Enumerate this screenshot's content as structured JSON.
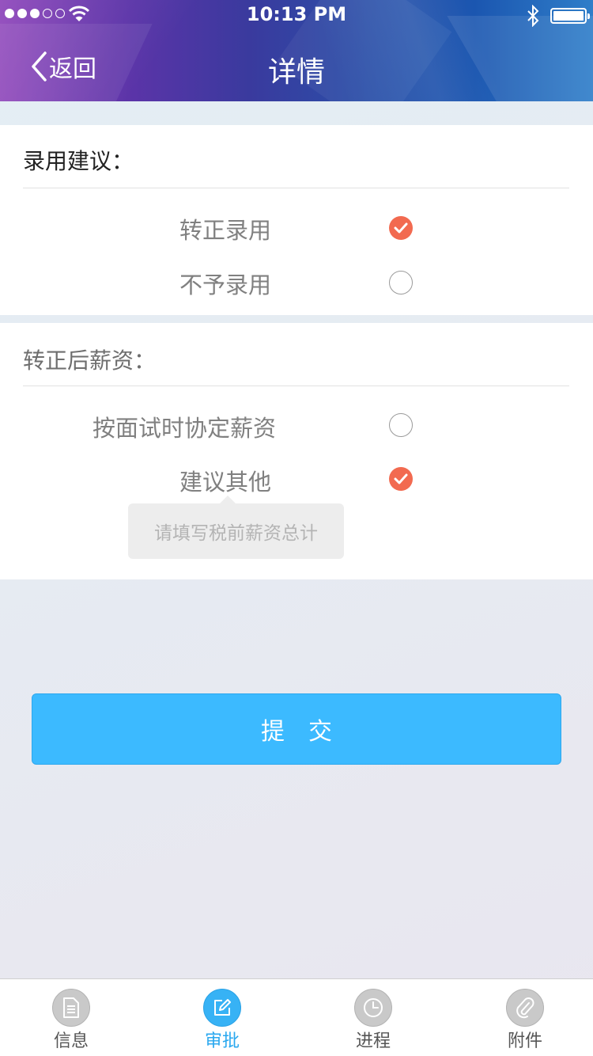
{
  "status_bar": {
    "time": "10:13 PM",
    "signal_filled": 3,
    "signal_total": 5,
    "battery_level": 1.0,
    "icons": [
      "signal-dots",
      "wifi-icon",
      "bluetooth-icon",
      "battery-icon"
    ]
  },
  "nav": {
    "back_label": "返回",
    "title": "详情"
  },
  "hire_section": {
    "title": "录用建议：",
    "options": [
      {
        "label": "转正录用",
        "selected": true
      },
      {
        "label": "不予录用",
        "selected": false
      }
    ]
  },
  "salary_section": {
    "title": "转正后薪资：",
    "options": [
      {
        "label": "按面试时协定薪资",
        "selected": false
      },
      {
        "label": "建议其他",
        "selected": true
      }
    ],
    "input_placeholder": "请填写税前薪资总计"
  },
  "submit_label": "提交",
  "tabs": [
    {
      "label": "信息",
      "icon": "document-icon",
      "active": false
    },
    {
      "label": "审批",
      "icon": "edit-icon",
      "active": true
    },
    {
      "label": "进程",
      "icon": "clock-icon",
      "active": false
    },
    {
      "label": "附件",
      "icon": "paperclip-icon",
      "active": false
    }
  ],
  "colors": {
    "accent_blue": "#3cbaff",
    "check_red": "#f26a50",
    "tab_active": "#2aa8ef"
  }
}
